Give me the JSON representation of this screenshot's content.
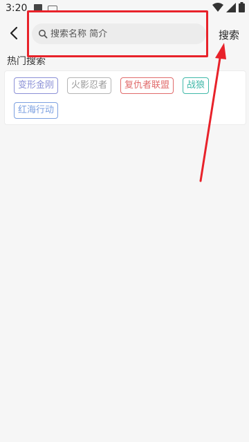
{
  "status_bar": {
    "time": "3:20",
    "icons": [
      "image-icon",
      "keyboard-icon",
      "wifi-icon",
      "signal-icon",
      "battery-icon"
    ]
  },
  "header": {
    "back_icon": "chevron-left-icon",
    "search": {
      "placeholder": "搜索名称 简介",
      "value": ""
    },
    "search_button_label": "搜索"
  },
  "hot_search": {
    "title": "热门搜索",
    "tags": [
      {
        "label": "变形金刚",
        "color": "#8a8fd6"
      },
      {
        "label": "火影忍者",
        "color": "#b4b4b4"
      },
      {
        "label": "复仇者联盟",
        "color": "#e06a6a"
      },
      {
        "label": "战狼",
        "color": "#3fb8a8"
      },
      {
        "label": "红海行动",
        "color": "#7b9fe0"
      }
    ]
  },
  "annotation": {
    "color": "#e8222a"
  }
}
